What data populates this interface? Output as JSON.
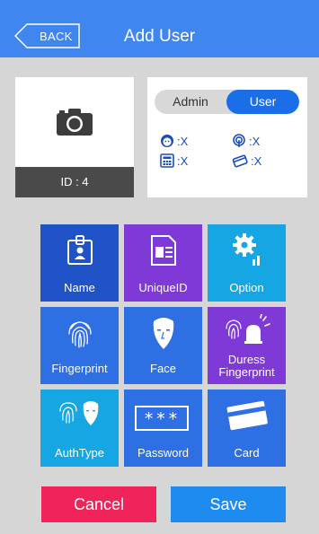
{
  "header": {
    "back_label": "BACK",
    "title": "Add User"
  },
  "photo": {
    "id_text": "ID : 4"
  },
  "role": {
    "admin_label": "Admin",
    "user_label": "User",
    "selected": "User"
  },
  "status": {
    "face": ":X",
    "fingerprint": ":X",
    "password": ":X",
    "card": ":X"
  },
  "tiles": [
    {
      "label": "Name",
      "icon": "id-badge-icon"
    },
    {
      "label": "UniqueID",
      "icon": "id-card-icon"
    },
    {
      "label": "Option",
      "icon": "gear-chart-icon"
    },
    {
      "label": "Fingerprint",
      "icon": "fingerprint-icon"
    },
    {
      "label": "Face",
      "icon": "face-icon"
    },
    {
      "label_line1": "Duress",
      "label_line2": "Fingerprint",
      "icon": "fingerprint-alarm-icon"
    },
    {
      "label": "AuthType",
      "icon": "fingerprint-face-icon"
    },
    {
      "label": "Password",
      "icon": "password-icon",
      "glyph": "***"
    },
    {
      "label": "Card",
      "icon": "card-icon"
    }
  ],
  "actions": {
    "cancel_label": "Cancel",
    "save_label": "Save"
  },
  "colors": {
    "header": "#3f87ee",
    "tile_blue": "#2f6fe4",
    "tile_purple": "#7e39d6",
    "tile_cyan": "#17a6e4",
    "cancel": "#f0245a",
    "save": "#1e8bf0"
  }
}
